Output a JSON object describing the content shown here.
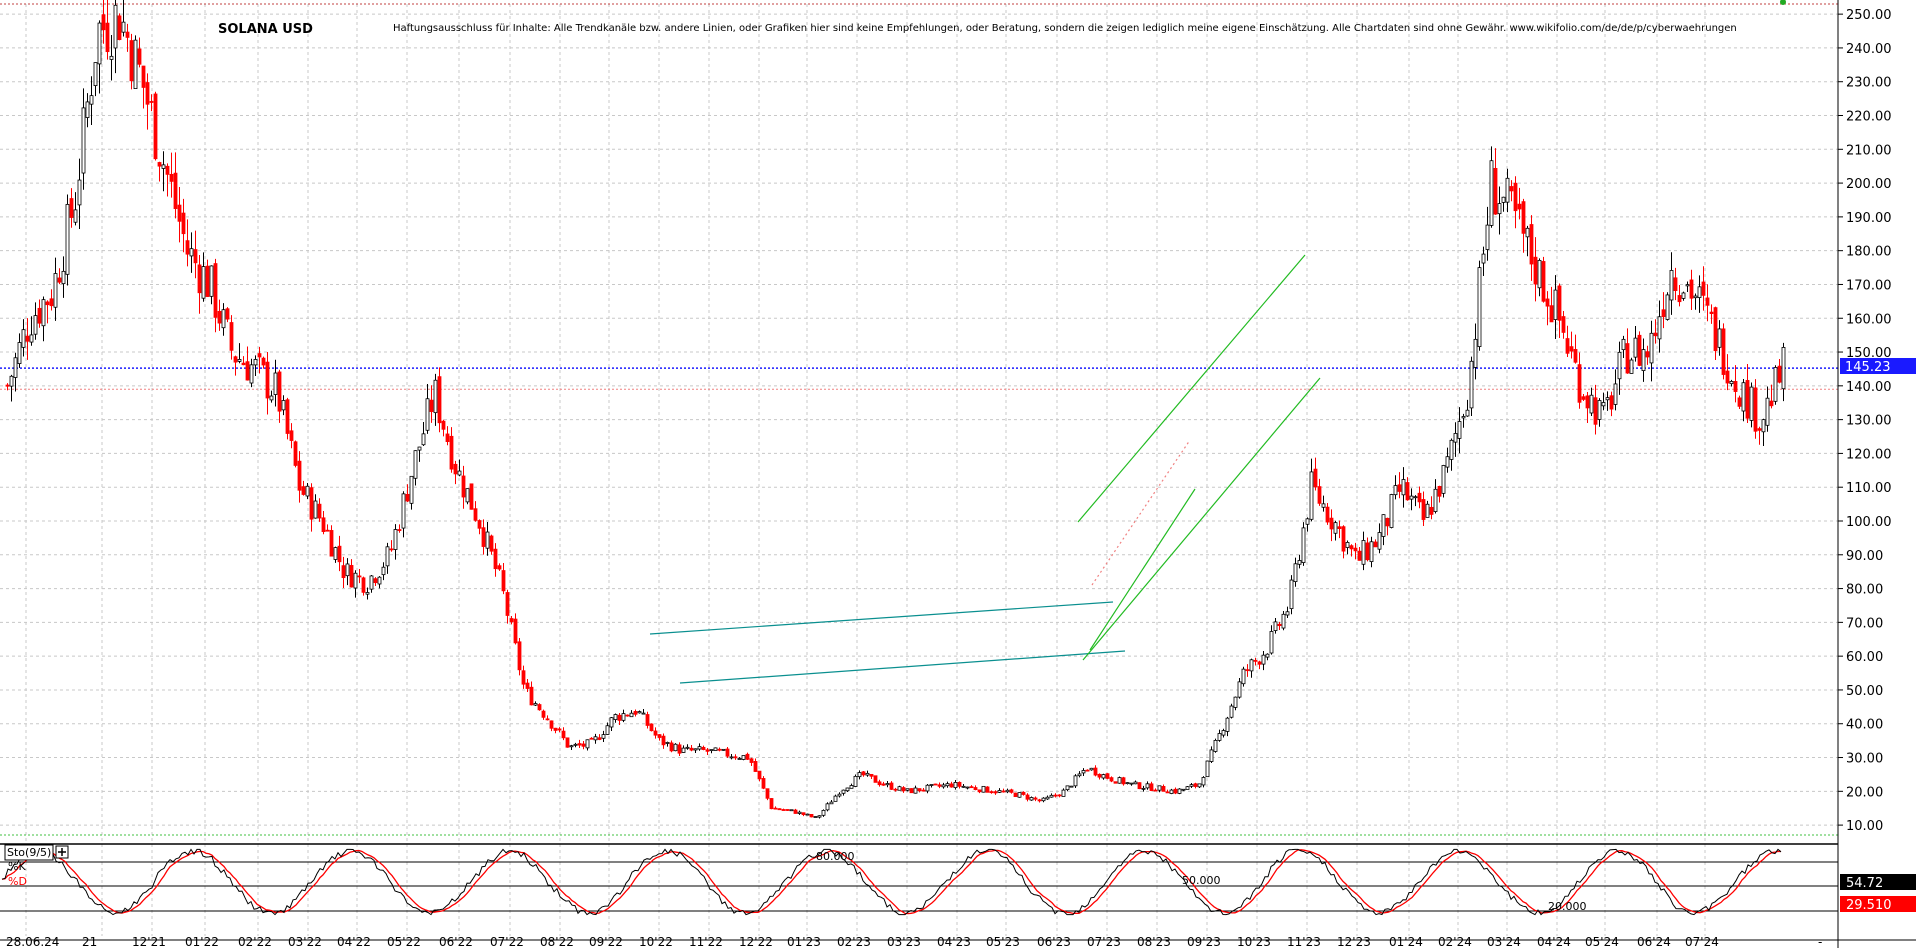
{
  "chart_data": {
    "type": "candlestick",
    "title": "SOLANA USD",
    "disclaimer": "Haftungsausschluss für Inhalte: Alle Trendkanäle bzw. andere Linien, oder Grafiken hier sind keine Empfehlungen, oder Beratung, sondern die zeigen lediglich meine eigene Einschätzung. Alle Chartdaten sind ohne Gewähr.  www.wikifolio.com/de/de/p/cyberwaehrungen",
    "y_axis": {
      "min": 5,
      "max": 253,
      "ticks": [
        "10.00",
        "20.00",
        "30.00",
        "40.00",
        "50.00",
        "60.00",
        "70.00",
        "80.00",
        "90.00",
        "100.00",
        "110.00",
        "120.00",
        "130.00",
        "140.00",
        "150.00",
        "160.00",
        "170.00",
        "180.00",
        "190.00",
        "200.00",
        "210.00",
        "220.00",
        "230.00",
        "240.00",
        "250.00"
      ]
    },
    "x_axis": {
      "ticks": [
        "28.06.24",
        "21",
        "12'21",
        "01'22",
        "02'22",
        "03'22",
        "04'22",
        "05'22",
        "06'22",
        "07'22",
        "08'22",
        "09'22",
        "10'22",
        "11'22",
        "12'22",
        "01'23",
        "02'23",
        "03'23",
        "04'23",
        "05'23",
        "06'23",
        "07'23",
        "08'23",
        "09'23",
        "10'23",
        "11'23",
        "12'23",
        "01'24",
        "02'24",
        "03'24",
        "04'24",
        "05'24",
        "06'24",
        "07'24"
      ]
    },
    "last_price": "145.23",
    "price_series": [
      [
        0,
        140
      ],
      [
        1,
        160
      ],
      [
        2,
        168
      ],
      [
        3,
        195
      ],
      [
        4,
        245
      ],
      [
        5,
        250
      ],
      [
        6,
        230
      ],
      [
        7,
        205
      ],
      [
        8,
        180
      ],
      [
        9,
        170
      ],
      [
        10,
        150
      ],
      [
        11,
        145
      ],
      [
        12,
        138
      ],
      [
        13,
        110
      ],
      [
        14,
        100
      ],
      [
        15,
        85
      ],
      [
        16,
        82
      ],
      [
        17,
        90
      ],
      [
        18,
        115
      ],
      [
        19,
        138
      ],
      [
        20,
        115
      ],
      [
        21,
        100
      ],
      [
        22,
        80
      ],
      [
        23,
        50
      ],
      [
        24,
        42
      ],
      [
        25,
        33
      ],
      [
        26,
        34
      ],
      [
        27,
        42
      ],
      [
        28,
        44
      ],
      [
        29,
        35
      ],
      [
        30,
        32
      ],
      [
        31,
        32
      ],
      [
        32,
        31
      ],
      [
        33,
        30
      ],
      [
        34,
        15
      ],
      [
        35,
        14
      ],
      [
        36,
        12
      ],
      [
        37,
        20
      ],
      [
        38,
        25
      ],
      [
        39,
        22
      ],
      [
        40,
        20
      ],
      [
        41,
        21
      ],
      [
        42,
        22
      ],
      [
        43,
        21
      ],
      [
        44,
        20
      ],
      [
        45,
        19
      ],
      [
        46,
        17
      ],
      [
        47,
        20
      ],
      [
        48,
        27
      ],
      [
        49,
        24
      ],
      [
        50,
        22
      ],
      [
        51,
        21
      ],
      [
        52,
        20
      ],
      [
        53,
        22
      ],
      [
        54,
        38
      ],
      [
        55,
        55
      ],
      [
        56,
        62
      ],
      [
        57,
        75
      ],
      [
        58,
        110
      ],
      [
        59,
        100
      ],
      [
        60,
        88
      ],
      [
        61,
        95
      ],
      [
        62,
        110
      ],
      [
        63,
        100
      ],
      [
        64,
        115
      ],
      [
        65,
        140
      ],
      [
        66,
        200
      ],
      [
        67,
        190
      ],
      [
        68,
        175
      ],
      [
        69,
        160
      ],
      [
        70,
        140
      ],
      [
        71,
        130
      ],
      [
        72,
        150
      ],
      [
        73,
        150
      ],
      [
        74,
        175
      ],
      [
        75,
        168
      ],
      [
        76,
        155
      ],
      [
        77,
        140
      ],
      [
        78,
        130
      ],
      [
        79,
        145
      ]
    ],
    "reference_lines": [
      {
        "label": "145.23",
        "value": 145.23,
        "color": "#1a1aff",
        "style": "dotted"
      },
      {
        "value": 139,
        "color": "#f08080",
        "style": "dotted"
      }
    ],
    "trend_lines": [
      {
        "color": "#0a8f8f",
        "points": [
          [
            650,
            634
          ],
          [
            1113,
            602
          ]
        ]
      },
      {
        "color": "#0a8f8f",
        "points": [
          [
            680,
            683
          ],
          [
            1125,
            651
          ]
        ]
      },
      {
        "color": "#22bb22",
        "points": [
          [
            1078,
            522
          ],
          [
            1305,
            255
          ]
        ]
      },
      {
        "color": "#22bb22",
        "points": [
          [
            1083,
            660
          ],
          [
            1320,
            378
          ]
        ]
      },
      {
        "color": "#22bb22",
        "points": [
          [
            1090,
            650
          ],
          [
            1195,
            489
          ]
        ]
      },
      {
        "color": "#f08080",
        "style": "dotted",
        "points": [
          [
            1092,
            585
          ],
          [
            1190,
            440
          ]
        ]
      }
    ],
    "stochastic": {
      "label": "Sto(9/5)",
      "k_label": "%K",
      "d_label": "%D",
      "levels": [
        "80.000",
        "50.000",
        "20.000"
      ],
      "k_value": "54.72",
      "d_value": "29.510"
    },
    "colors": {
      "up": "#000000",
      "down": "#ff0000",
      "k_line": "#000000",
      "d_line": "#ff0000",
      "grid": "#c8c8c8"
    }
  }
}
